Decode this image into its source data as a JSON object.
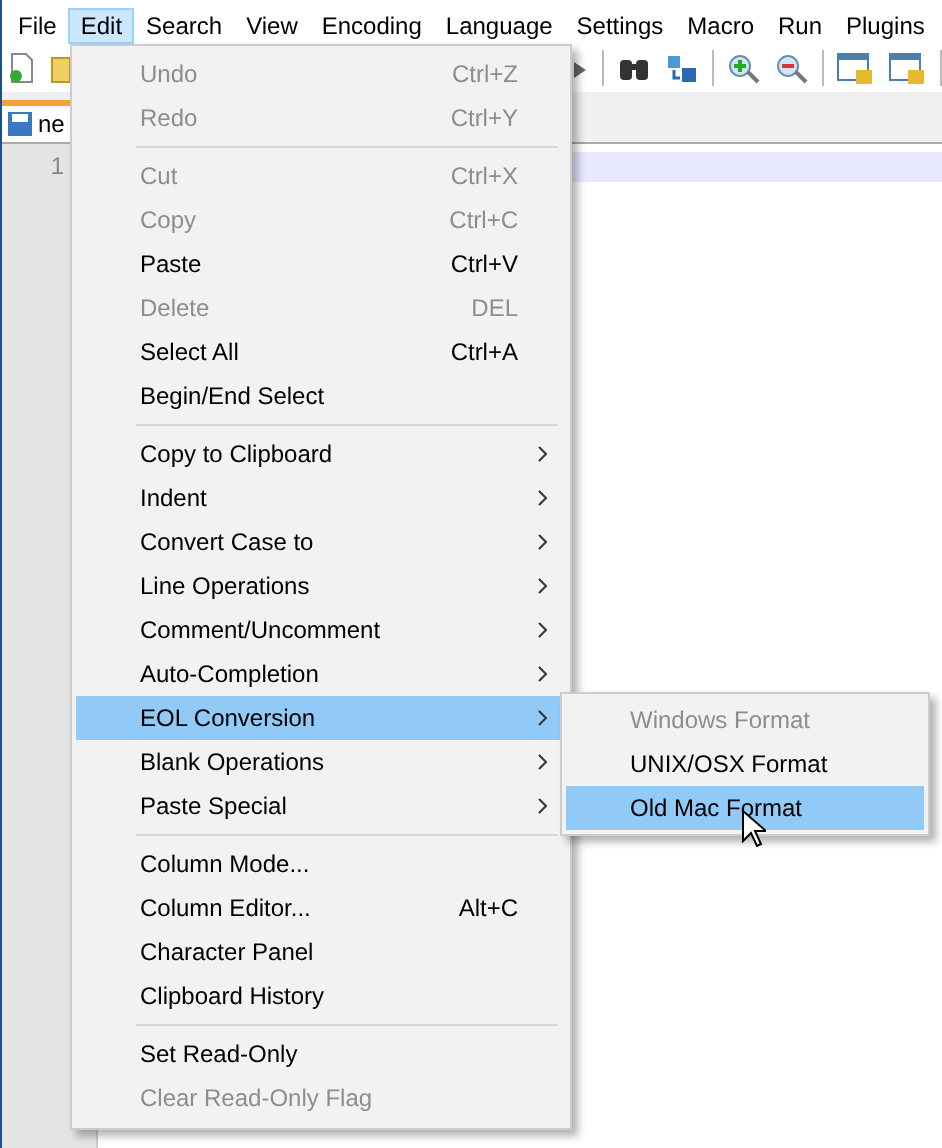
{
  "menubar": [
    {
      "label": "File",
      "selected": false
    },
    {
      "label": "Edit",
      "selected": true
    },
    {
      "label": "Search",
      "selected": false
    },
    {
      "label": "View",
      "selected": false
    },
    {
      "label": "Encoding",
      "selected": false
    },
    {
      "label": "Language",
      "selected": false
    },
    {
      "label": "Settings",
      "selected": false
    },
    {
      "label": "Macro",
      "selected": false
    },
    {
      "label": "Run",
      "selected": false
    },
    {
      "label": "Plugins",
      "selected": false
    }
  ],
  "tab": {
    "label": "ne"
  },
  "editor": {
    "line_numbers": [
      "1"
    ]
  },
  "edit_menu": [
    {
      "kind": "item",
      "label": "Undo",
      "shortcut": "Ctrl+Z",
      "disabled": true,
      "submenu": false,
      "selected": false
    },
    {
      "kind": "item",
      "label": "Redo",
      "shortcut": "Ctrl+Y",
      "disabled": true,
      "submenu": false,
      "selected": false
    },
    {
      "kind": "separator"
    },
    {
      "kind": "item",
      "label": "Cut",
      "shortcut": "Ctrl+X",
      "disabled": true,
      "submenu": false,
      "selected": false
    },
    {
      "kind": "item",
      "label": "Copy",
      "shortcut": "Ctrl+C",
      "disabled": true,
      "submenu": false,
      "selected": false
    },
    {
      "kind": "item",
      "label": "Paste",
      "shortcut": "Ctrl+V",
      "disabled": false,
      "submenu": false,
      "selected": false
    },
    {
      "kind": "item",
      "label": "Delete",
      "shortcut": "DEL",
      "disabled": true,
      "submenu": false,
      "selected": false
    },
    {
      "kind": "item",
      "label": "Select All",
      "shortcut": "Ctrl+A",
      "disabled": false,
      "submenu": false,
      "selected": false
    },
    {
      "kind": "item",
      "label": "Begin/End Select",
      "disabled": false,
      "submenu": false,
      "selected": false
    },
    {
      "kind": "separator"
    },
    {
      "kind": "item",
      "label": "Copy to Clipboard",
      "disabled": false,
      "submenu": true,
      "selected": false
    },
    {
      "kind": "item",
      "label": "Indent",
      "disabled": false,
      "submenu": true,
      "selected": false
    },
    {
      "kind": "item",
      "label": "Convert Case to",
      "disabled": false,
      "submenu": true,
      "selected": false
    },
    {
      "kind": "item",
      "label": "Line Operations",
      "disabled": false,
      "submenu": true,
      "selected": false
    },
    {
      "kind": "item",
      "label": "Comment/Uncomment",
      "disabled": false,
      "submenu": true,
      "selected": false
    },
    {
      "kind": "item",
      "label": "Auto-Completion",
      "disabled": false,
      "submenu": true,
      "selected": false
    },
    {
      "kind": "item",
      "label": "EOL Conversion",
      "disabled": false,
      "submenu": true,
      "selected": true
    },
    {
      "kind": "item",
      "label": "Blank Operations",
      "disabled": false,
      "submenu": true,
      "selected": false
    },
    {
      "kind": "item",
      "label": "Paste Special",
      "disabled": false,
      "submenu": true,
      "selected": false
    },
    {
      "kind": "separator"
    },
    {
      "kind": "item",
      "label": "Column Mode...",
      "disabled": false,
      "submenu": false,
      "selected": false
    },
    {
      "kind": "item",
      "label": "Column Editor...",
      "shortcut": "Alt+C",
      "disabled": false,
      "submenu": false,
      "selected": false
    },
    {
      "kind": "item",
      "label": "Character Panel",
      "disabled": false,
      "submenu": false,
      "selected": false
    },
    {
      "kind": "item",
      "label": "Clipboard History",
      "disabled": false,
      "submenu": false,
      "selected": false
    },
    {
      "kind": "separator"
    },
    {
      "kind": "item",
      "label": "Set Read-Only",
      "disabled": false,
      "submenu": false,
      "selected": false
    },
    {
      "kind": "item",
      "label": "Clear Read-Only Flag",
      "disabled": true,
      "submenu": false,
      "selected": false
    }
  ],
  "eol_submenu": [
    {
      "label": "Windows Format",
      "disabled": true,
      "selected": false
    },
    {
      "label": "UNIX/OSX Format",
      "disabled": false,
      "selected": false
    },
    {
      "label": "Old Mac Format",
      "disabled": false,
      "selected": true
    }
  ]
}
